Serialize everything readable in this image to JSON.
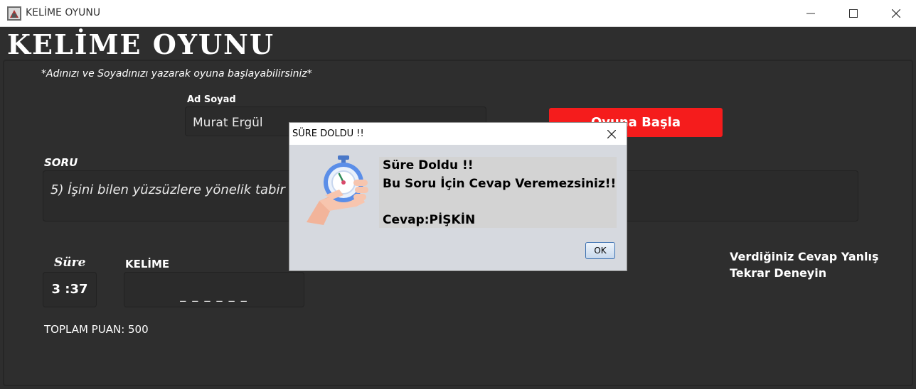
{
  "window": {
    "title": "KELİME OYUNU",
    "app_icon": "java-app-icon"
  },
  "header": {
    "title": "KELİME OYUNU"
  },
  "hint": "*Adınızı ve Soyadınızı yazarak oyuna başlayabilirsiniz*",
  "player": {
    "label": "Ad Soyad",
    "value": "Murat Ergül"
  },
  "start_button": {
    "label": "Oyuna Başla",
    "color": "#f51c1c"
  },
  "question": {
    "label": "SORU",
    "text": "5) İşini bilen yüzsüzlere yönelik tabir"
  },
  "timer": {
    "label": "Süre",
    "value": "3 :37"
  },
  "word": {
    "label": "KELİME",
    "masked": "_ _ _ _ _ _"
  },
  "score": {
    "text": "TOPLAM PUAN: 500"
  },
  "feedback": {
    "line1": "Verdiğiniz Cevap Yanlış",
    "line2": "Tekrar Deneyin"
  },
  "dialog": {
    "title": "SÜRE DOLDU !!",
    "line1": "Süre Doldu !!",
    "line2": "Bu Soru İçin Cevap Veremezsiniz!!",
    "line3": "Cevap:PİŞKİN",
    "ok_label": "OK",
    "icon": "stopwatch-hand-icon"
  }
}
